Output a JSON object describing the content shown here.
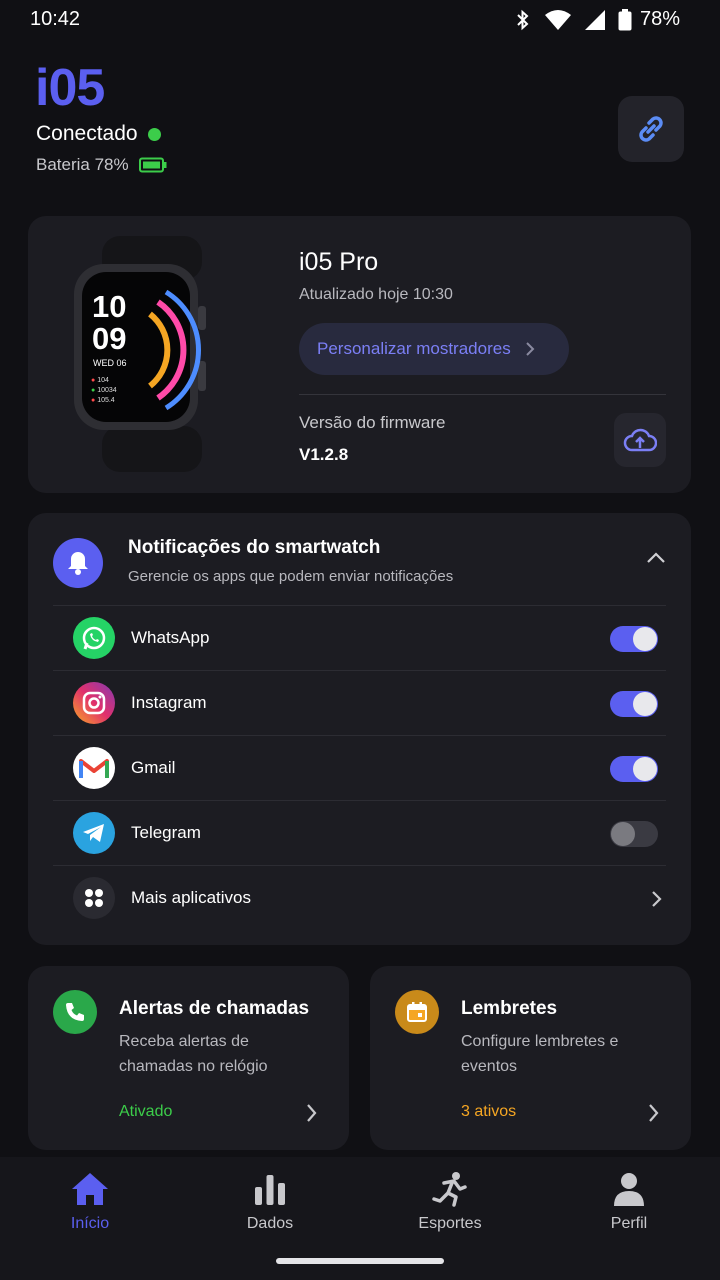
{
  "status_bar": {
    "time": "10:42",
    "battery": "78%"
  },
  "header": {
    "brand": "i05",
    "connection": "Conectado",
    "battery_label": "Bateria 78%"
  },
  "device": {
    "name": "i05 Pro",
    "updated": "Atualizado hoje 10:30",
    "customize_label": "Personalizar mostradores",
    "firmware_label": "Versão do firmware",
    "firmware_value": "V1.2.8",
    "watch_face": {
      "hour": "10",
      "minute": "09",
      "date": "WED 06",
      "stats": [
        "104",
        "10034",
        "105.4"
      ]
    }
  },
  "notifications": {
    "title": "Notificações do smartwatch",
    "subtitle": "Gerencie os apps que podem enviar notificações",
    "apps": [
      {
        "name": "WhatsApp",
        "enabled": true
      },
      {
        "name": "Instagram",
        "enabled": true
      },
      {
        "name": "Gmail",
        "enabled": true
      },
      {
        "name": "Telegram",
        "enabled": false
      }
    ],
    "more_label": "Mais aplicativos"
  },
  "features": [
    {
      "title": "Alertas de chamadas",
      "desc": "Receba alertas de chamadas no relógio",
      "status": "Ativado",
      "status_color": "#3ccd4a",
      "icon": "phone-icon",
      "icon_bg": "#2aa84a"
    },
    {
      "title": "Lembretes",
      "desc": "Configure lembretes e eventos",
      "status": "3 ativos",
      "status_color": "#f5a623",
      "icon": "calendar-icon",
      "icon_bg": "#f5a623"
    }
  ],
  "nav": [
    {
      "label": "Início",
      "active": true,
      "icon": "home-icon"
    },
    {
      "label": "Dados",
      "active": false,
      "icon": "bar-chart-icon"
    },
    {
      "label": "Esportes",
      "active": false,
      "icon": "running-icon"
    },
    {
      "label": "Perfil",
      "active": false,
      "icon": "person-icon"
    }
  ],
  "colors": {
    "accent": "#5b5ff0",
    "connected": "#3ccd4a",
    "background": "#101014",
    "card": "#1c1c22"
  }
}
